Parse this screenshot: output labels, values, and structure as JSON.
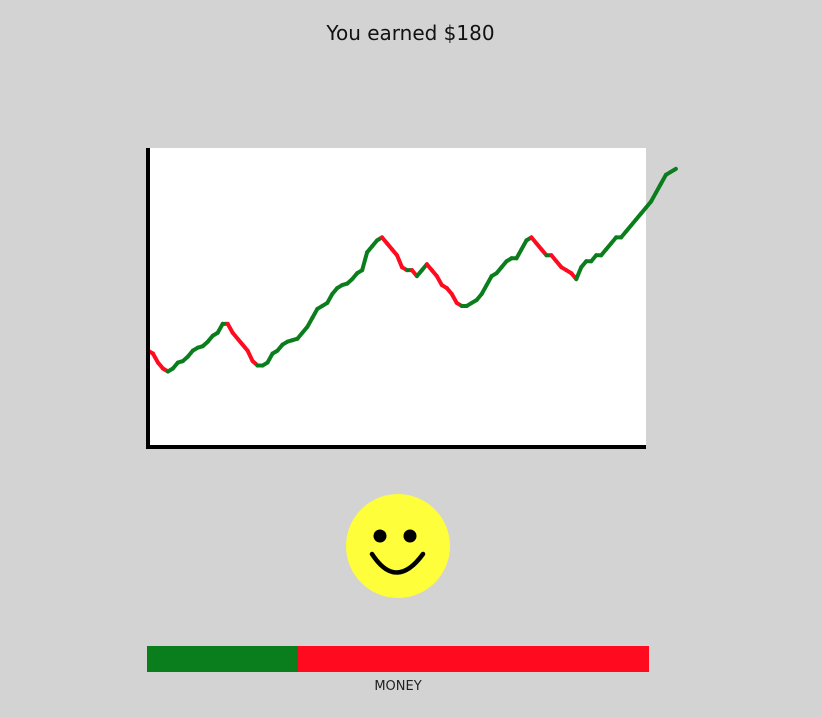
{
  "header": {
    "title": "You earned $180"
  },
  "money_meter": {
    "label": "MONEY",
    "fraction": 0.3
  },
  "face": {
    "mood": "happy",
    "icon": "smiley-face-icon"
  },
  "colors": {
    "background": "#d3d3d3",
    "up": "#0a7d1c",
    "down": "#ff0a1e",
    "face": "#fefe3a",
    "axis": "#000000",
    "plot_bg": "#ffffff"
  },
  "chart_data": {
    "type": "line",
    "title": "",
    "xlabel": "",
    "ylabel": "",
    "xlim": [
      0,
      100
    ],
    "ylim": [
      0,
      100
    ],
    "grid": false,
    "legend": "none",
    "series": [
      {
        "x": [
          0,
          1,
          2,
          3,
          4,
          5,
          6,
          7,
          8,
          9,
          10,
          11,
          12,
          13,
          14,
          15,
          16,
          17,
          18,
          19,
          20,
          21,
          22,
          23,
          24,
          25,
          26,
          27,
          28,
          29,
          30,
          31,
          32,
          33,
          34,
          35,
          36,
          37,
          38,
          39,
          40,
          41,
          42,
          43,
          44,
          45,
          46,
          47,
          48,
          49,
          50,
          51,
          52,
          53,
          54,
          55,
          56,
          57,
          58,
          59,
          60,
          61,
          62,
          63,
          64,
          65,
          66,
          67,
          68,
          69,
          70,
          71,
          72,
          73,
          74,
          75,
          76,
          77,
          78,
          79,
          80,
          81,
          82,
          83,
          84,
          85,
          86,
          87,
          88,
          89,
          90,
          91,
          92,
          93,
          94,
          95,
          96,
          97,
          98,
          99,
          100,
          101,
          102,
          103,
          104,
          105,
          106
        ],
        "y": [
          32,
          31,
          28,
          26,
          25,
          26,
          28,
          28.5,
          30,
          32,
          33,
          33.5,
          35,
          37,
          38,
          41,
          41,
          38,
          36,
          34,
          32,
          28.5,
          27,
          27,
          28,
          31,
          32,
          34,
          35,
          35.5,
          36,
          38,
          40,
          43,
          46,
          47,
          48,
          51,
          53,
          54,
          54.5,
          56,
          58,
          59,
          65,
          67,
          69,
          70,
          68,
          66,
          64,
          60,
          59,
          59,
          57,
          59,
          61,
          59,
          57,
          54,
          53,
          51,
          48,
          47,
          47,
          48,
          49,
          51,
          54,
          57,
          58,
          60,
          62,
          63,
          63,
          66,
          69,
          70,
          68,
          66,
          64,
          64,
          62,
          60,
          59,
          58,
          56,
          60,
          62,
          62,
          64,
          64,
          66,
          68,
          70,
          70,
          72,
          74,
          76,
          78,
          80,
          82,
          85,
          88,
          91,
          92,
          93
        ]
      }
    ]
  }
}
